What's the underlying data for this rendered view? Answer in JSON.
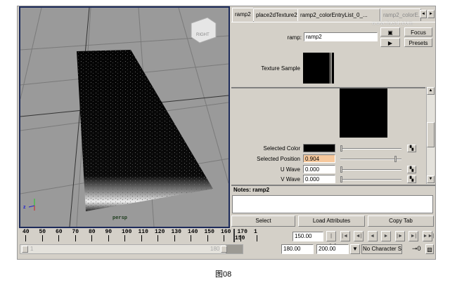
{
  "viewport": {
    "camera_label": "persp",
    "view_cube_label": "RIGHT",
    "axis_labels": {
      "y": "Y",
      "z": "Z",
      "x": "X"
    }
  },
  "tabs": [
    "ramp2",
    "place2dTexture2",
    "ramp2_colorEntryList_0_...",
    "ramp2_colorE..."
  ],
  "tab_scroll": {
    "left": "◄",
    "right": "►"
  },
  "node": {
    "label": "ramp:",
    "value": "ramp2"
  },
  "buttons": {
    "focus": "Focus",
    "presets": "Presets",
    "select": "Select",
    "load_attributes": "Load Attributes",
    "copy_tab": "Copy Tab"
  },
  "texture_sample_label": "Texture Sample",
  "attributes": [
    {
      "label": "Selected Color",
      "value": "",
      "slider": 0.0
    },
    {
      "label": "Selected Position",
      "value": "0.904",
      "slider": 0.904
    },
    {
      "label": "U Wave",
      "value": "0.000",
      "slider": 0.0
    },
    {
      "label": "V Wave",
      "value": "0.000",
      "slider": 0.0
    }
  ],
  "notes": {
    "title": "Notes:  ramp2",
    "text": ""
  },
  "timeline": {
    "ticks": [
      "40",
      "50",
      "60",
      "70",
      "80",
      "90",
      "100",
      "110",
      "120",
      "130",
      "140",
      "150",
      "160",
      "170",
      "1"
    ],
    "current_frame_marker": "150",
    "current_time": "150.00"
  },
  "playback": [
    "|◄◄",
    "|◄",
    "◄|",
    "◄",
    "►",
    "|►",
    "►|",
    "►►|"
  ],
  "range": {
    "start_label": "1",
    "end_label": "180",
    "end_time": "180.00",
    "end_total": "200.00",
    "character_set": "No Character Set"
  },
  "watermark": "www.hxsd.com",
  "caption": "图08",
  "colors": {
    "viewport_border": "#1c2a5a",
    "panel_bg": "#d4d0c8",
    "highlight_field": "#f6c89c"
  }
}
